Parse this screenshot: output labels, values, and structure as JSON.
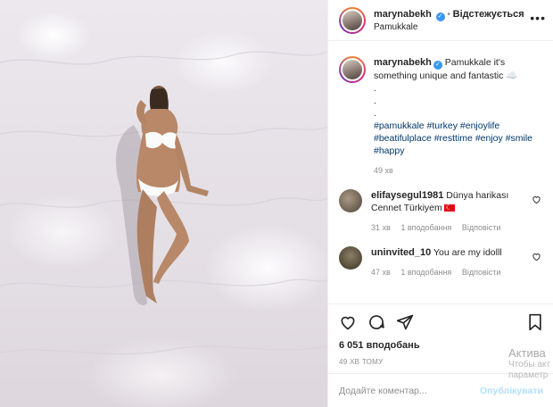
{
  "post": {
    "username": "marynabekh",
    "follow_status": "Відстежується",
    "location": "Pamukkale",
    "caption_text": "Pamukkale it's something unique and fantastic ☁️",
    "caption_dots": [
      ".",
      ".",
      "."
    ],
    "hashtags_line1": "#pamukkale #turkey #enjoylife",
    "hashtags_line2": "#beatifulplace #resttime #enjoy #smile",
    "hashtags_line3": "#happy",
    "caption_time": "49 хв"
  },
  "comments": [
    {
      "username": "elifaysegul1981",
      "text": "Dünya harikası Cennet Türkiyem",
      "time": "31 хв",
      "replies": "1 вподобання",
      "reply_label": "Відповісти"
    },
    {
      "username": "uninvited_10",
      "text": "You are my idolll",
      "time": "47 хв",
      "replies": "1 вподобання",
      "reply_label": "Відповісти"
    }
  ],
  "stats": {
    "likes": "6 051 вподобань",
    "posted_ago": "49 ХВ ТОМУ"
  },
  "comment_box": {
    "placeholder": "Додайте коментар...",
    "post_label": "Опублікувати"
  },
  "watermark": {
    "line1": "Актива",
    "line2": "Чтобы акт",
    "line3": "параметр"
  },
  "icons": [
    "heart-icon",
    "comment-icon",
    "share-icon",
    "bookmark-icon",
    "more-icon",
    "verified-icon"
  ],
  "colors": {
    "accent": "#3897f0",
    "link": "#00376b",
    "muted": "#8e8e8e",
    "post_disabled": "#b2dffc"
  }
}
